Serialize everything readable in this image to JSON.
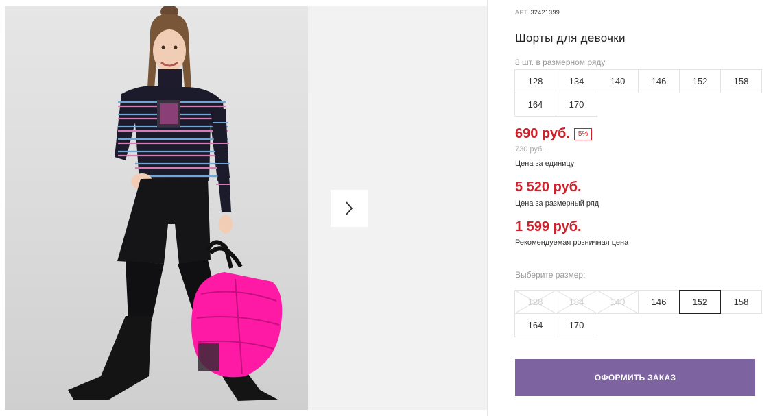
{
  "product": {
    "sku_label": "АРТ.",
    "sku_value": "32421399",
    "title": "Шорты для девочки",
    "image_description_icon": "product-photo"
  },
  "pack": {
    "label": "8 шт. в размерном ряду",
    "sizes": [
      "128",
      "134",
      "140",
      "146",
      "152",
      "158",
      "164",
      "170"
    ]
  },
  "prices": {
    "unit_price": "690 руб.",
    "discount": "5%",
    "old_price": "730 руб.",
    "unit_caption": "Цена за единицу",
    "pack_price": "5 520 руб.",
    "pack_caption": "Цена за размерный ряд",
    "retail_price": "1 599 руб.",
    "retail_caption": "Рекомендуемая розничная цена"
  },
  "size_select": {
    "label": "Выберите размер:",
    "options": [
      {
        "size": "128",
        "available": false
      },
      {
        "size": "134",
        "available": false
      },
      {
        "size": "140",
        "available": false
      },
      {
        "size": "146",
        "available": true
      },
      {
        "size": "152",
        "available": true,
        "selected": true
      },
      {
        "size": "158",
        "available": true
      },
      {
        "size": "164",
        "available": true
      },
      {
        "size": "170",
        "available": true
      }
    ]
  },
  "actions": {
    "order_label": "ОФОРМИТЬ ЗАКАЗ",
    "next_icon": "chevron-right-icon"
  },
  "colors": {
    "price_red": "#d0202a",
    "button_purple": "#7d64a0",
    "gallery_bg": "#f2f2f2"
  }
}
